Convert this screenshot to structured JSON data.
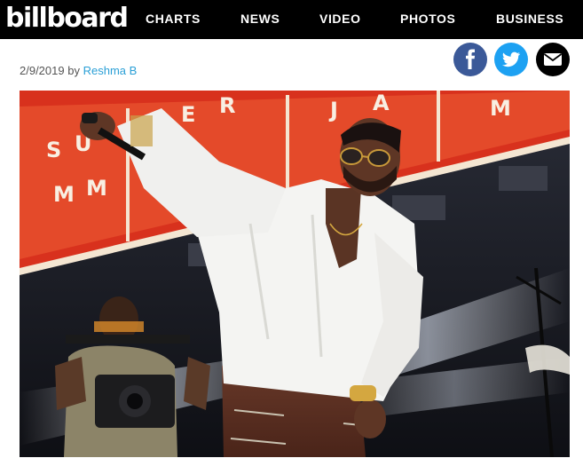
{
  "header": {
    "logo": "billboard",
    "nav": [
      "CHARTS",
      "NEWS",
      "VIDEO",
      "PHOTOS",
      "BUSINESS"
    ]
  },
  "article": {
    "date": "2/9/2019",
    "by": "by",
    "author": "Reshma B"
  },
  "share": [
    {
      "icon": "facebook-icon",
      "color": "#3b5998"
    },
    {
      "icon": "twitter-icon",
      "color": "#1da1f2"
    },
    {
      "icon": "email-icon",
      "color": "#000000"
    }
  ],
  "hero": {
    "banner_letters": [
      "S",
      "U",
      "M",
      "M",
      "E",
      "R",
      "J",
      "A",
      "M"
    ],
    "colors": {
      "banner": "#e0341f",
      "stage": "#1a1c24",
      "shirt": "#f4f4f2"
    }
  }
}
